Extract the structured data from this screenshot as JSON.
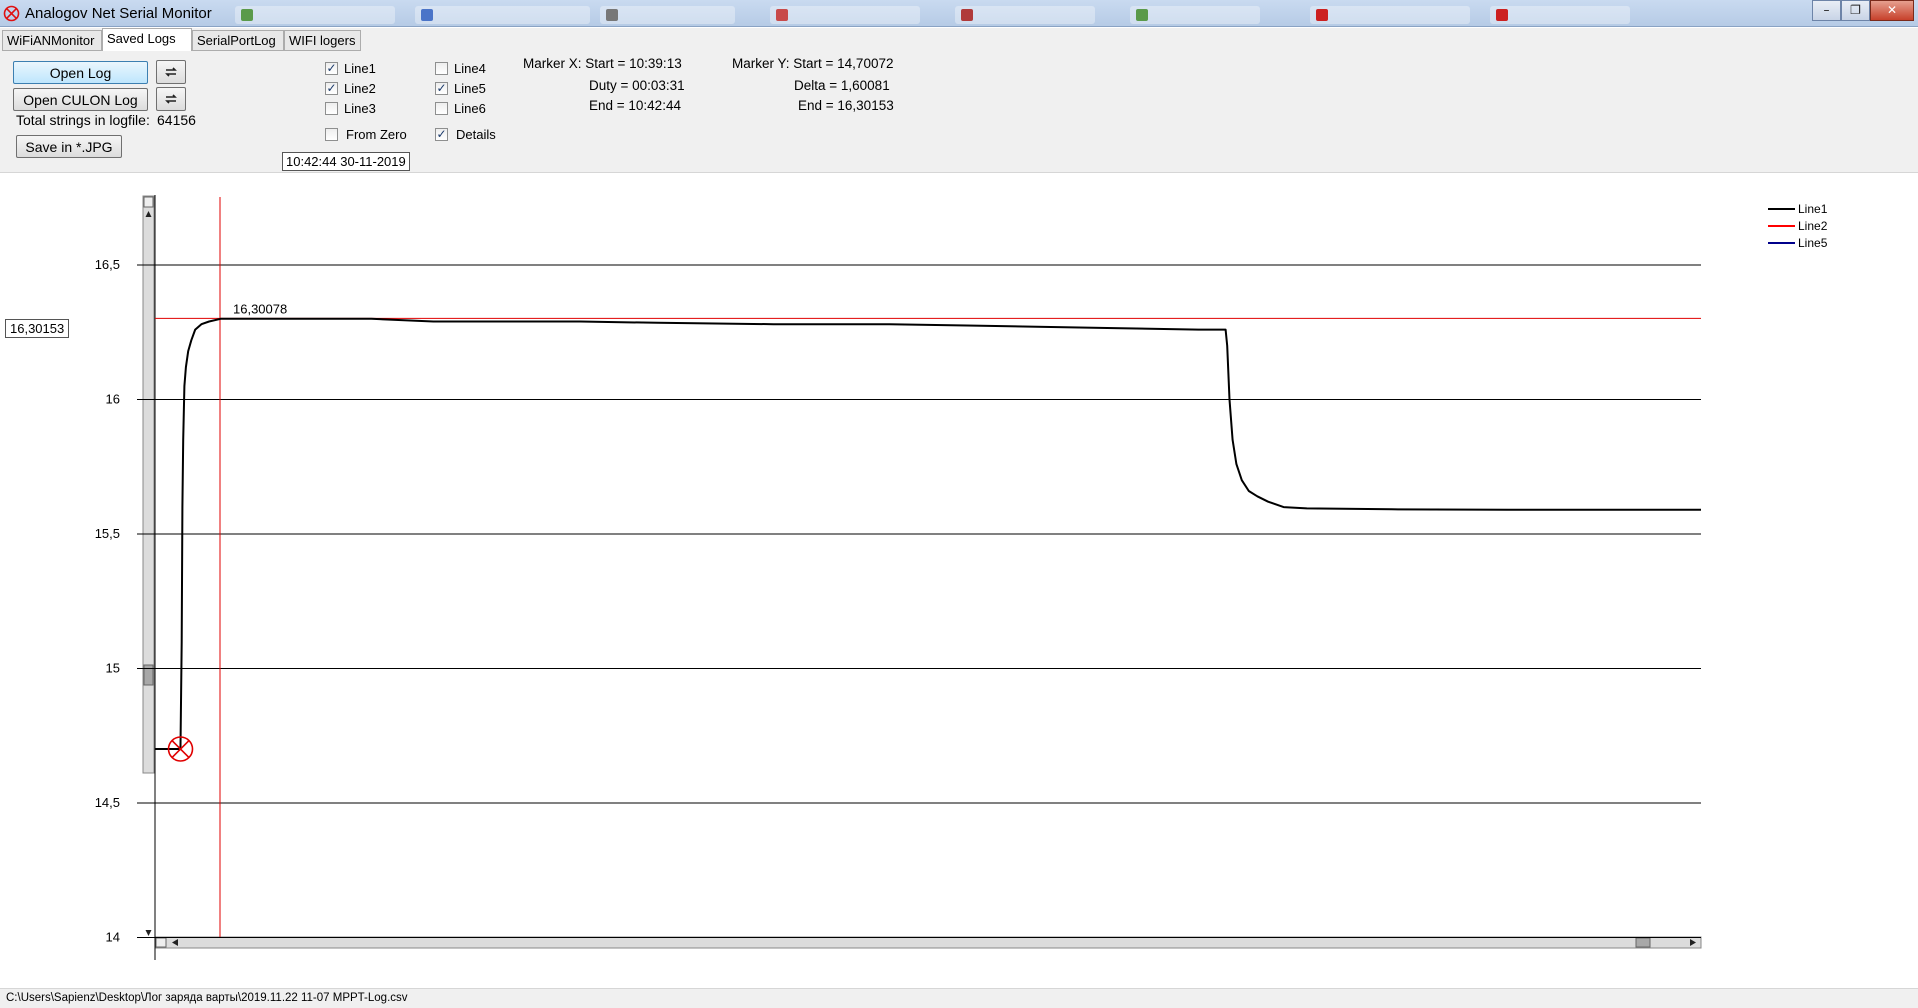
{
  "window": {
    "title": "Analogov Net Serial Monitor",
    "icon": "crossed-circle-icon"
  },
  "tabs": [
    {
      "label": "WiFiANMonitor",
      "active": false
    },
    {
      "label": "Saved Logs",
      "active": true
    },
    {
      "label": "SerialPortLog",
      "active": false
    },
    {
      "label": "WIFI logers",
      "active": false
    }
  ],
  "toolbar": {
    "open_log": "Open Log",
    "open_culon_log": "Open CULON Log",
    "total_strings_label": "Total strings in logfile:",
    "total_strings_value": "64156",
    "save_jpg": "Save in *.JPG",
    "refresh_icon": "refresh-arrows-icon"
  },
  "lines": {
    "line1": {
      "label": "Line1",
      "checked": true
    },
    "line2": {
      "label": "Line2",
      "checked": true
    },
    "line3": {
      "label": "Line3",
      "checked": false
    },
    "line4": {
      "label": "Line4",
      "checked": false
    },
    "line5": {
      "label": "Line5",
      "checked": true
    },
    "line6": {
      "label": "Line6",
      "checked": false
    }
  },
  "options": {
    "from_zero": {
      "label": "From Zero",
      "checked": false
    },
    "details": {
      "label": "Details",
      "checked": true
    }
  },
  "datetime": "10:42:44 30-11-2019",
  "marker_x": {
    "start": "Marker X: Start = 10:39:13",
    "duty": "Duty = 00:03:31",
    "end": "End  = 10:42:44"
  },
  "marker_y": {
    "start": "Marker Y: Start = 14,70072",
    "delta": "Delta = 1,60081",
    "end": "End  = 16,30153"
  },
  "cursor_value": "16,30153",
  "status_path": "C:\\Users\\Sapienz\\Desktop\\Лог заряда варты\\2019.11.22 11-07 MPPT-Log.csv",
  "colors": {
    "line1": "#000000",
    "line2": "#ff0000",
    "line5": "#00008b",
    "marker": "#e00000",
    "grid": "#000000"
  },
  "chart_data": {
    "type": "line",
    "title": "",
    "xlabel": "",
    "ylabel": "",
    "ylim": [
      14,
      16.8
    ],
    "yticks": [
      14,
      14.5,
      15,
      15.5,
      16,
      16.5
    ],
    "ytick_labels": [
      "14",
      "14,5",
      "15",
      "15,5",
      "16",
      "16,5"
    ],
    "grid": true,
    "legend_position": "top-right",
    "legend": [
      "Line1",
      "Line2",
      "Line5"
    ],
    "marker_label": "16,30078",
    "horizontal_marker_value": 16.30153,
    "series": [
      {
        "name": "Line1",
        "points": [
          [
            0,
            14.70072
          ],
          [
            3.2,
            14.70072
          ],
          [
            3.3,
            14.71
          ],
          [
            3.45,
            15.1
          ],
          [
            3.55,
            15.6
          ],
          [
            3.65,
            15.85
          ],
          [
            3.8,
            16.05
          ],
          [
            4.0,
            16.12
          ],
          [
            4.3,
            16.18
          ],
          [
            4.7,
            16.22
          ],
          [
            5.2,
            16.26
          ],
          [
            6.0,
            16.28
          ],
          [
            7.0,
            16.29
          ],
          [
            8.5,
            16.3
          ],
          [
            13,
            16.3
          ],
          [
            20,
            16.3
          ],
          [
            28,
            16.3
          ],
          [
            36,
            16.29
          ],
          [
            45,
            16.29
          ],
          [
            55,
            16.29
          ],
          [
            65,
            16.285
          ],
          [
            80,
            16.28
          ],
          [
            95,
            16.28
          ],
          [
            105,
            16.275
          ],
          [
            115,
            16.27
          ],
          [
            125,
            16.265
          ],
          [
            135,
            16.26
          ],
          [
            138.5,
            16.26
          ],
          [
            138.7,
            16.2
          ],
          [
            139,
            16.0
          ],
          [
            139.4,
            15.85
          ],
          [
            139.9,
            15.76
          ],
          [
            140.6,
            15.7
          ],
          [
            141.5,
            15.66
          ],
          [
            142.6,
            15.64
          ],
          [
            144,
            15.62
          ],
          [
            146,
            15.6
          ],
          [
            149,
            15.595
          ],
          [
            160,
            15.592
          ],
          [
            175,
            15.59
          ],
          [
            188,
            15.59
          ],
          [
            200,
            15.59
          ]
        ]
      }
    ]
  }
}
